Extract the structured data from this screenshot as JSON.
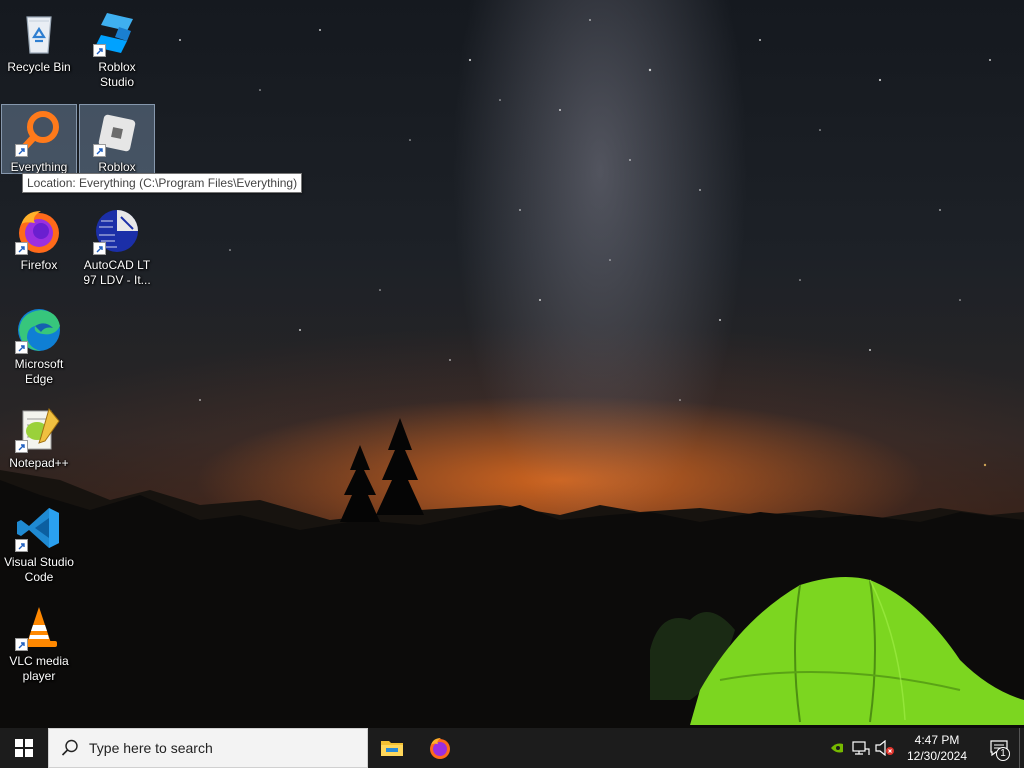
{
  "desktop": {
    "icons": [
      {
        "label": "Recycle Bin"
      },
      {
        "label": "Roblox Studio"
      },
      {
        "label": "Everything"
      },
      {
        "label": "Roblox Player"
      },
      {
        "label": "Firefox"
      },
      {
        "label": "AutoCAD LT\n97 LDV - It..."
      },
      {
        "label": "Microsoft\nEdge"
      },
      {
        "label": "Notepad++"
      },
      {
        "label": "Visual Studio\nCode"
      },
      {
        "label": "VLC media\nplayer"
      }
    ],
    "tooltip": "Location: Everything (C:\\Program Files\\Everything)"
  },
  "taskbar": {
    "search_placeholder": "Type here to search",
    "pinned": [
      "file-explorer-icon",
      "firefox-icon"
    ],
    "clock_time": "4:47 PM",
    "clock_date": "12/30/2024",
    "notification_count": "1"
  },
  "colors": {
    "taskbar": "#1c1c1c",
    "search_box": "#f3f3f3",
    "selection": "#99b7db",
    "tent_green": "#7cd620"
  }
}
